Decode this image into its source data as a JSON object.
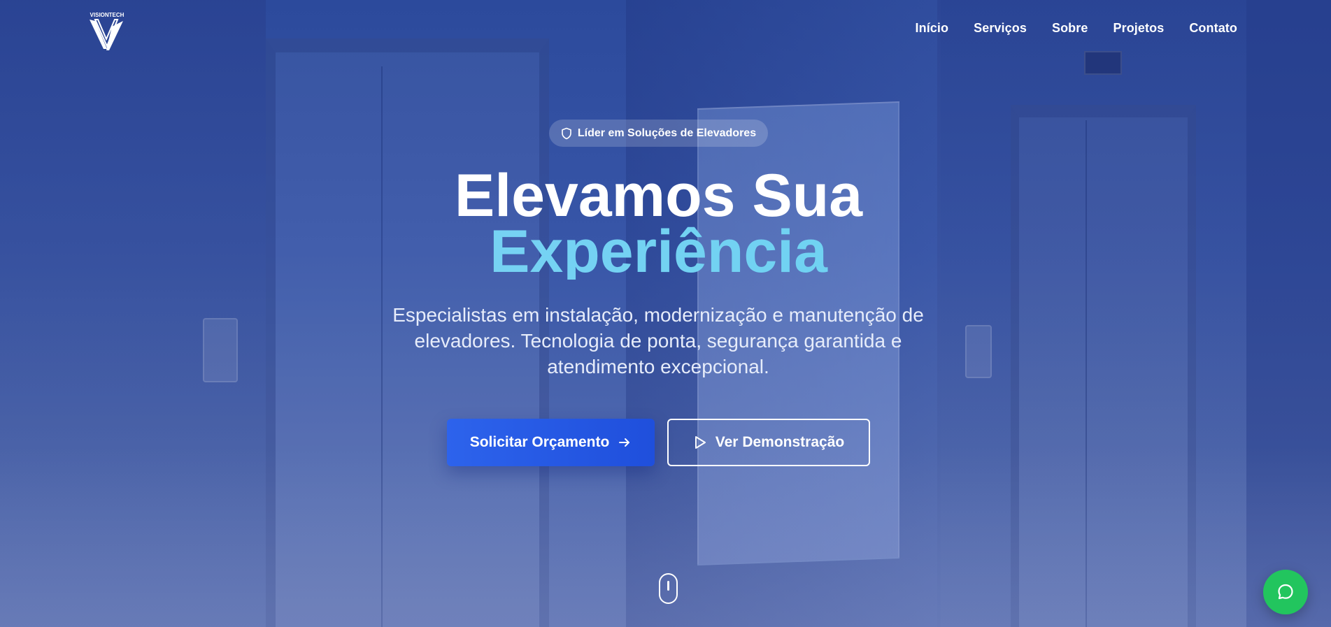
{
  "brand": {
    "logo_text": "VISIONTECH",
    "logo_icon": "v-monogram-icon"
  },
  "nav": {
    "items": [
      {
        "label": "Início"
      },
      {
        "label": "Serviços"
      },
      {
        "label": "Sobre"
      },
      {
        "label": "Projetos"
      },
      {
        "label": "Contato"
      }
    ]
  },
  "hero": {
    "badge": {
      "icon": "shield-icon",
      "text": "Líder em Soluções de Elevadores"
    },
    "title_line1": "Elevamos Sua",
    "title_line2": "Experiência",
    "subtitle": "Especialistas em instalação, modernização e manutenção de elevadores. Tecnologia de ponta, segurança garantida e atendimento excepcional.",
    "primary_button": {
      "label": "Solicitar Orçamento",
      "icon": "arrow-right-icon"
    },
    "secondary_button": {
      "label": "Ver Demonstração",
      "icon": "play-icon"
    },
    "scroll_indicator_icon": "mouse-scroll-icon"
  },
  "chat": {
    "icon": "chat-bubble-icon"
  },
  "colors": {
    "accent_cyan": "#6ED3F3",
    "primary_blue": "#2D63EC",
    "chat_green": "#22C55E",
    "overlay_blue": "#2C4A9C"
  }
}
